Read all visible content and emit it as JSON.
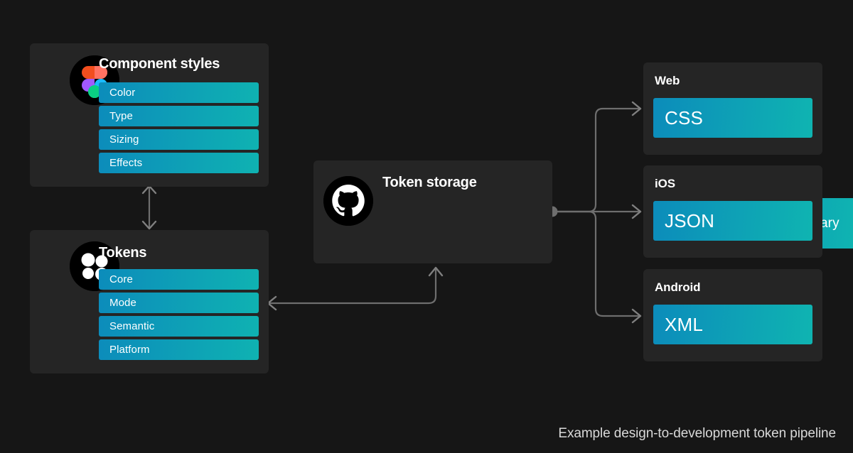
{
  "meta": {
    "caption": "Example design-to-development token pipeline",
    "background_color": "#161616",
    "card_color": "#252525",
    "pill_gradient_from": "#0c8cbb",
    "pill_gradient_to": "#0fb4b1",
    "connector_color": "#6e6e6e",
    "text_color": "#ffffff"
  },
  "cards": {
    "component_styles": {
      "title": "Component styles",
      "icon": "figma-logo-icon",
      "items": [
        {
          "label": "Color"
        },
        {
          "label": "Type"
        },
        {
          "label": "Sizing"
        },
        {
          "label": "Effects"
        }
      ]
    },
    "tokens": {
      "title": "Tokens",
      "icon": "tokens-studio-logo-icon",
      "items": [
        {
          "label": "Core"
        },
        {
          "label": "Mode"
        },
        {
          "label": "Semantic"
        },
        {
          "label": "Platform"
        }
      ]
    },
    "token_storage": {
      "title": "Token storage",
      "icon": "github-logo-icon",
      "item": "JSON style dictionary"
    }
  },
  "outputs": [
    {
      "title": "Web",
      "format": "CSS"
    },
    {
      "title": "iOS",
      "format": "JSON"
    },
    {
      "title": "Android",
      "format": "XML"
    }
  ],
  "connectors": [
    {
      "name": "component-styles-tokens-bidirectional",
      "style": "double-arrow-vertical"
    },
    {
      "name": "tokens-to-token-storage",
      "style": "arrow-up"
    },
    {
      "name": "token-storage-to-tokens",
      "style": "arrow-left"
    },
    {
      "name": "token-storage-to-web",
      "style": "arrow-right"
    },
    {
      "name": "token-storage-to-ios",
      "style": "arrow-right"
    },
    {
      "name": "token-storage-to-android",
      "style": "arrow-right"
    }
  ]
}
